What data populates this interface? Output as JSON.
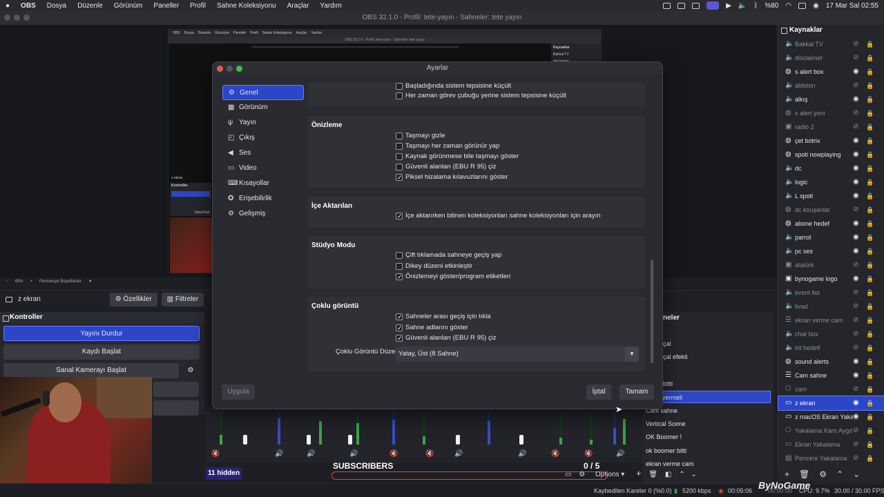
{
  "menubar": {
    "app": "OBS",
    "items": [
      "Dosya",
      "Düzenle",
      "Görünüm",
      "Paneller",
      "Profil",
      "Sahne Koleksiyonu",
      "Araçlar",
      "Yardım"
    ],
    "battery": "%80",
    "datetime": "17 Mar Sal  02:55"
  },
  "window": {
    "title": "OBS 32.1.0 - Profil: tete-yayın - Sahneler: tete yayın"
  },
  "nested_preview": {
    "menubar": [
      "OBS",
      "Dosya",
      "Düzenle",
      "Görünüm",
      "Paneller",
      "Profil",
      "Sahne Koleksiyonu",
      "Araçlar",
      "Yardım"
    ],
    "title": "OBS 32.1.0 - Profil: tete-yayın - Sahneler: tete yayın",
    "sources_title": "Kaynaklar",
    "source_1": "Bakkal TV",
    "source_2": "disclaimer",
    "z_ekran": "z ekran",
    "kontroller": "Kontroller",
    "sanal": "Sanal Kar"
  },
  "preview_status": {
    "zoom": "49%",
    "fit": "Pencereye Boyutlandır"
  },
  "source_toolbar": {
    "current_source": "z ekran",
    "properties": "Özellikler",
    "filters": "Filtreler"
  },
  "controls": {
    "title": "Kontroller",
    "stop_stream": "Yayını Durdur",
    "start_record": "Kaydı Başlat",
    "start_virtual_cam": "Sanal Kamerayı Başlat"
  },
  "scenes": {
    "title": "neler",
    "items": [
      "çal",
      "çal efekti",
      "bitti",
      "Cam sahne",
      "Vertical Scene",
      "OK Boomer !",
      "ok boomer bitti",
      "ekran verme cam"
    ],
    "active": "vermeli"
  },
  "sources": {
    "title": "Kaynaklar",
    "items": [
      {
        "label": "Bakkal TV",
        "icon": "audio-icon",
        "visible": false,
        "dim": true
      },
      {
        "label": "disclaimer",
        "icon": "audio-icon",
        "visible": false,
        "dim": true
      },
      {
        "label": "s alert box",
        "icon": "browser-icon",
        "visible": true,
        "dim": false
      },
      {
        "label": "ableton",
        "icon": "audio-icon",
        "visible": false,
        "dim": true
      },
      {
        "label": "alkış",
        "icon": "audio-icon",
        "visible": true,
        "dim": false
      },
      {
        "label": "s alert yeni",
        "icon": "browser-icon",
        "visible": false,
        "dim": true
      },
      {
        "label": "radio 2",
        "icon": "image-icon",
        "visible": false,
        "dim": true
      },
      {
        "label": "çet botrix",
        "icon": "browser-icon",
        "visible": true,
        "dim": false
      },
      {
        "label": "spoti nowplaying",
        "icon": "browser-icon",
        "visible": true,
        "dim": false
      },
      {
        "label": "dc",
        "icon": "audio-icon",
        "visible": true,
        "dim": false
      },
      {
        "label": "logic",
        "icon": "audio-icon",
        "visible": true,
        "dim": false
      },
      {
        "label": "L spoti",
        "icon": "audio-icon",
        "visible": true,
        "dim": false
      },
      {
        "label": "dc kouşanlar",
        "icon": "browser-icon",
        "visible": false,
        "dim": true
      },
      {
        "label": "abone hedef",
        "icon": "browser-icon",
        "visible": true,
        "dim": false
      },
      {
        "label": "parrot",
        "icon": "audio-icon",
        "visible": true,
        "dim": false
      },
      {
        "label": "pc ses",
        "icon": "audio-icon",
        "visible": true,
        "dim": false
      },
      {
        "label": "atatürk",
        "icon": "image-icon",
        "visible": false,
        "dim": true
      },
      {
        "label": "bynogame logo",
        "icon": "image-icon",
        "visible": true,
        "dim": false
      },
      {
        "label": "event list",
        "icon": "audio-icon",
        "visible": false,
        "dim": true
      },
      {
        "label": "livad",
        "icon": "audio-icon",
        "visible": false,
        "dim": true
      },
      {
        "label": "ekran verme cam",
        "icon": "group-icon",
        "visible": false,
        "dim": true
      },
      {
        "label": "chat box",
        "icon": "audio-icon",
        "visible": false,
        "dim": true
      },
      {
        "label": "bit hedefi",
        "icon": "audio-icon",
        "visible": false,
        "dim": true
      },
      {
        "label": "sound alerts",
        "icon": "browser-icon",
        "visible": true,
        "dim": false
      },
      {
        "label": "Cam sahne",
        "icon": "group-icon",
        "visible": true,
        "dim": false
      },
      {
        "label": "cam",
        "icon": "camera-icon",
        "visible": false,
        "dim": true
      },
      {
        "label": "z ekran",
        "icon": "display-icon",
        "visible": true,
        "dim": false,
        "active": true
      },
      {
        "label": "z macOS Ekran Yakalama",
        "icon": "display-icon",
        "visible": true,
        "dim": false
      },
      {
        "label": "Yakalama Kartı Aygıtı",
        "icon": "camera-icon",
        "visible": false,
        "dim": true
      },
      {
        "label": "Ekran Yakalama",
        "icon": "display-icon",
        "visible": false,
        "dim": true
      },
      {
        "label": "Pencere Yakalama",
        "icon": "window-icon",
        "visible": false,
        "dim": true
      }
    ]
  },
  "mixer_footer": {
    "hidden": "11 hidden",
    "subscribers": "SUBSCRIBERS",
    "subs_count": "0  / 5",
    "options": "Options"
  },
  "statusbar": {
    "dropped": "Kaybedilen Kareler 0 (%0.0)",
    "bitrate": "5200 kbps",
    "stream_time": "00:05:06",
    "rec_time": "00:00:00",
    "cpu": "CPU: 9.7%",
    "fps": "30.00 / 30.00 FPS",
    "watermark": "ByNoGame"
  },
  "settings": {
    "title": "Ayarlar",
    "nav": [
      {
        "label": "Genel",
        "icon": "gear-icon",
        "selected": true
      },
      {
        "label": "Görünüm",
        "icon": "palette-icon"
      },
      {
        "label": "Yayın",
        "icon": "antenna-icon"
      },
      {
        "label": "Çıkış",
        "icon": "output-icon"
      },
      {
        "label": "Ses",
        "icon": "speaker-icon"
      },
      {
        "label": "Video",
        "icon": "monitor-icon"
      },
      {
        "label": "Kısayollar",
        "icon": "keyboard-icon"
      },
      {
        "label": "Erişebilirlik",
        "icon": "accessibility-icon"
      },
      {
        "label": "Gelişmiş",
        "icon": "advanced-gear-icon"
      }
    ],
    "tray_group": {
      "items": [
        {
          "label": "Başladığında sistem tepsisine küçült",
          "checked": false
        },
        {
          "label": "Her zaman görev çubuğu yerine sistem tepsisine küçült",
          "checked": false
        }
      ]
    },
    "preview_group": {
      "title": "Önizleme",
      "items": [
        {
          "label": "Taşmayı gizle",
          "checked": false
        },
        {
          "label": "Taşmayı her zaman görünür yap",
          "checked": false
        },
        {
          "label": "Kaynak görünmese bile taşmayı göster",
          "checked": false
        },
        {
          "label": "Güvenli alanları (EBU R 95) çiz",
          "checked": false
        },
        {
          "label": "Piksel hizalama kılavuzlarını göster",
          "checked": true
        }
      ]
    },
    "import_group": {
      "title": "İçe Aktarılan",
      "items": [
        {
          "label": "İçe aktarırken bilinen koleksiyonları sahne koleksiyonları için arayın",
          "checked": true
        }
      ]
    },
    "studio_group": {
      "title": "Stüdyo Modu",
      "items": [
        {
          "label": "Çift tıklamada sahneye geçiş yap",
          "checked": false
        },
        {
          "label": "Dikey düzeni etkinleştir",
          "checked": false
        },
        {
          "label": "Önizlemeyi göster/program etiketleri",
          "checked": true
        }
      ]
    },
    "multiview_group": {
      "title": "Çoklu görüntü",
      "items": [
        {
          "label": "Sahneler arası geçiş için tıkla",
          "checked": true
        },
        {
          "label": "Sahne adlarını göster",
          "checked": true
        },
        {
          "label": "Güvenli alanları (EBU R 95) çiz",
          "checked": true
        }
      ],
      "layout_label": "Çoklu Görüntü Düzeni",
      "layout_value": "Yatay, Üst (8 Sahne)"
    },
    "buttons": {
      "apply": "Uygula",
      "cancel": "İptal",
      "ok": "Tamam"
    }
  },
  "colors": {
    "accent": "#2c46c8",
    "record_red": "#e0443a",
    "meter_green": "#3aa64a"
  }
}
